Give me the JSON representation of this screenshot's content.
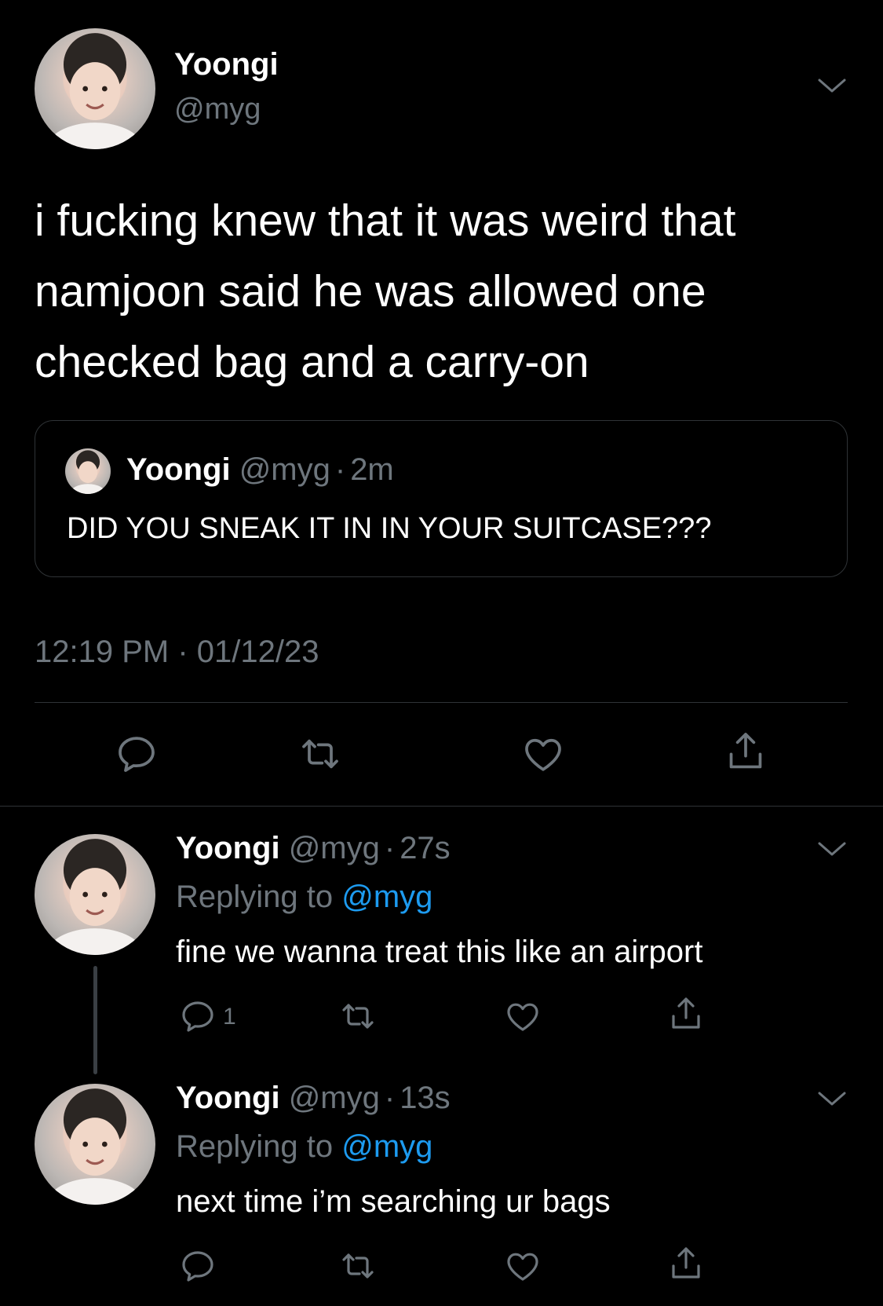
{
  "main_tweet": {
    "author_name": "Yoongi",
    "handle": "@myg",
    "text_lines": [
      "i fucking knew that it was weird that",
      "namjoon said he was allowed one",
      "checked bag and a carry-on"
    ],
    "quoted": {
      "author_name": "Yoongi",
      "handle": "@myg",
      "sep": "·",
      "time": "2m",
      "text": "DID YOU SNEAK IT IN IN YOUR SUITCASE???"
    },
    "timestamp": "12:19 PM · 01/12/23",
    "icons": [
      "reply-icon",
      "retweet-icon",
      "like-icon",
      "share-icon"
    ]
  },
  "replies": [
    {
      "author_name": "Yoongi",
      "handle": "@myg",
      "sep": "·",
      "time": "27s",
      "replying_prefix": "Replying to",
      "replying_handle": "@myg",
      "text": "fine we wanna treat this like an airport",
      "reply_count": "1"
    },
    {
      "author_name": "Yoongi",
      "handle": "@myg",
      "sep": "·",
      "time": "13s",
      "replying_prefix": "Replying to",
      "replying_handle": "@myg",
      "text": "next time i’m searching ur bags",
      "reply_count": ""
    }
  ],
  "colors": {
    "background": "#000000",
    "text": "#ffffff",
    "secondary": "#6e767d",
    "link": "#1d9bf0",
    "divider": "#2f3336"
  }
}
